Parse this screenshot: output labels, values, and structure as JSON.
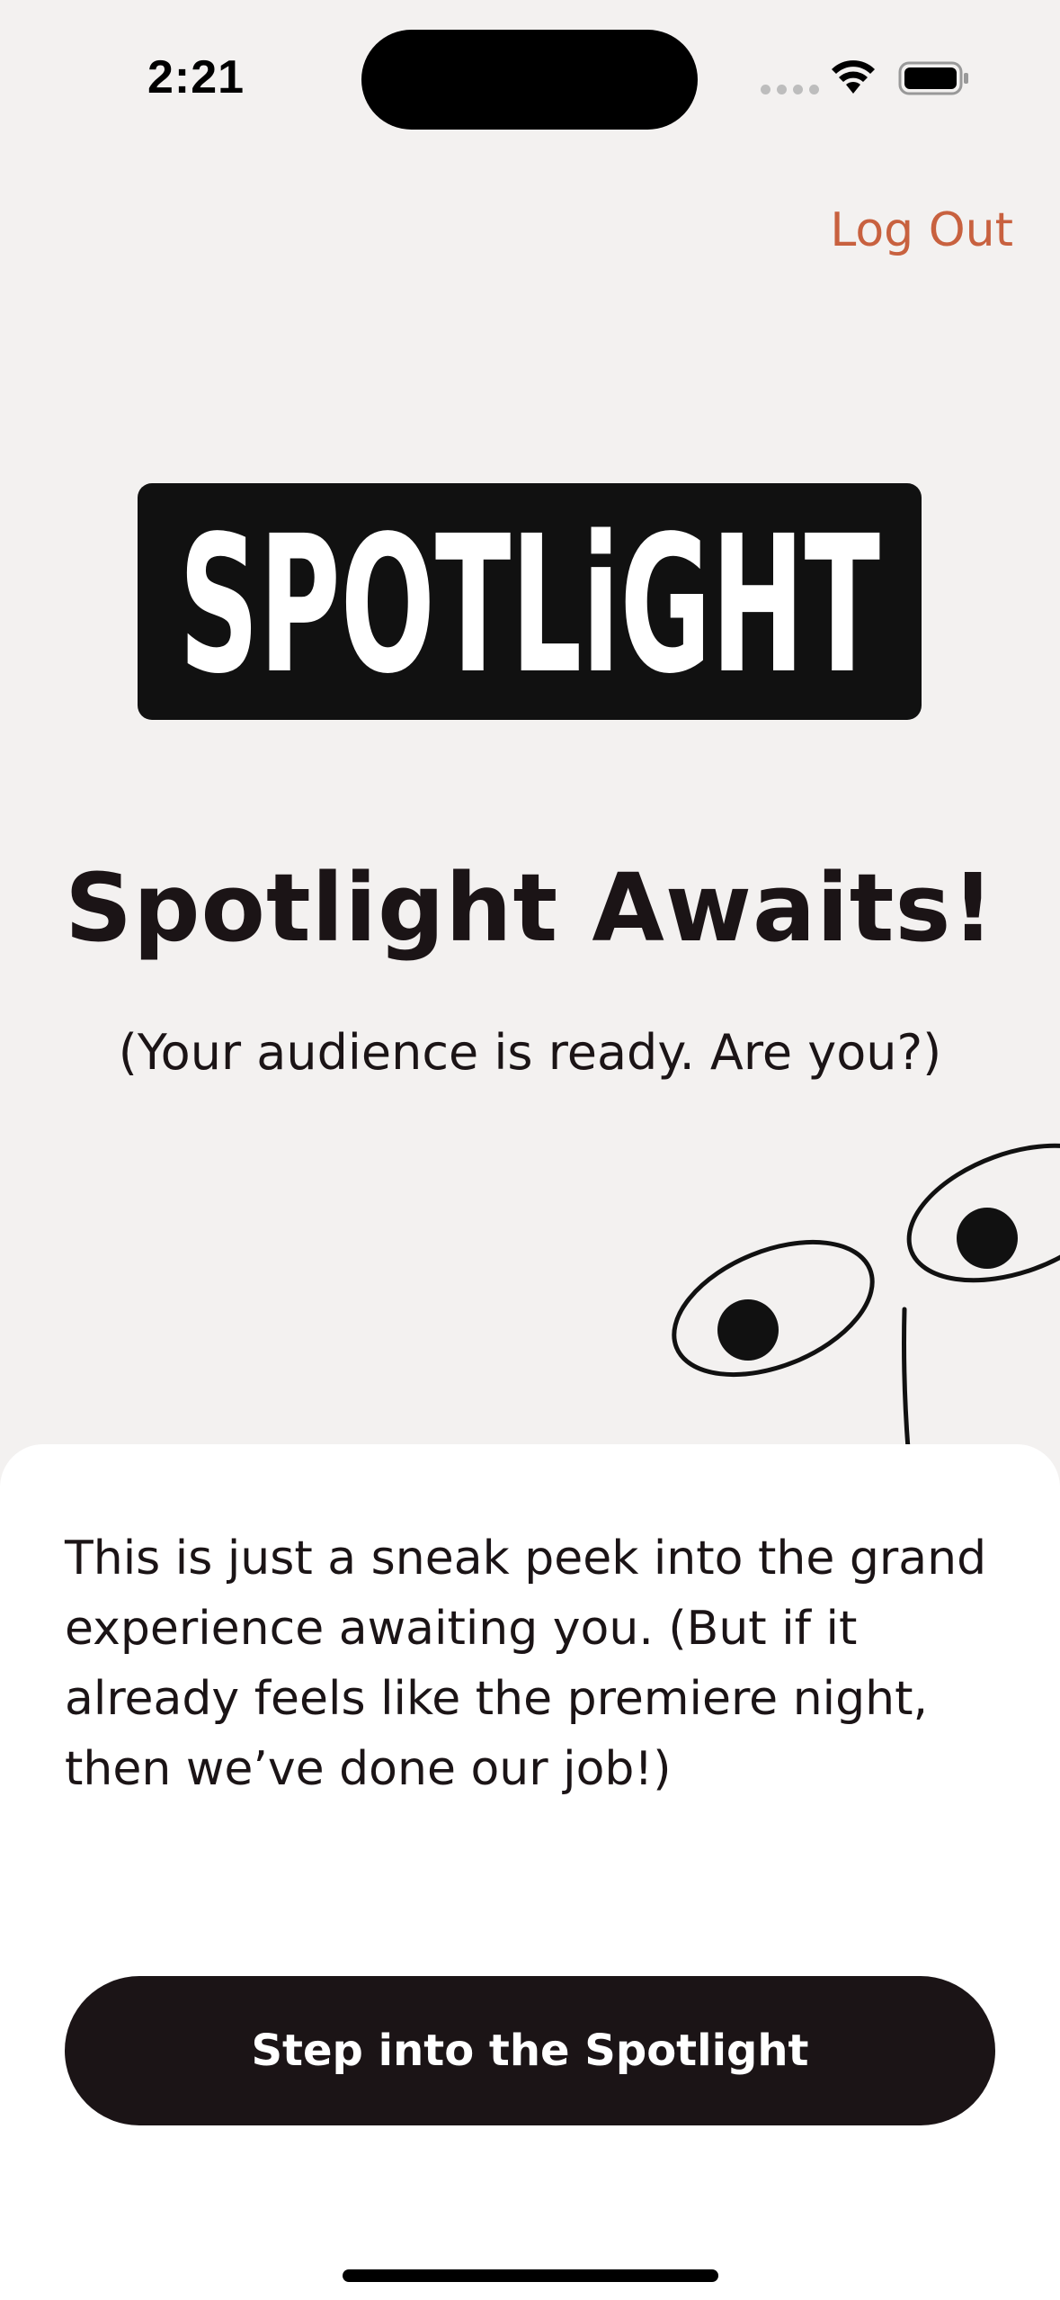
{
  "status_bar": {
    "time": "2:21"
  },
  "header": {
    "logout_label": "Log Out"
  },
  "logo": {
    "text": "SPOTLiGHT"
  },
  "hero": {
    "title": "Spotlight Awaits!",
    "subtitle": "(Your audience is ready. Are you?)"
  },
  "sheet": {
    "body": "This is just a sneak peek into the grand experience awaiting you. (But if it already feels like the premiere night, then we’ve done our job!)",
    "cta_label": "Step into the Spotlight"
  },
  "colors": {
    "background": "#f3f1f0",
    "accent": "#c8613f",
    "dark": "#1b1416",
    "sheet": "#ffffff"
  },
  "icons": [
    "wifi-icon",
    "battery-icon",
    "cellular-signal-icon",
    "eyes-illustration"
  ]
}
